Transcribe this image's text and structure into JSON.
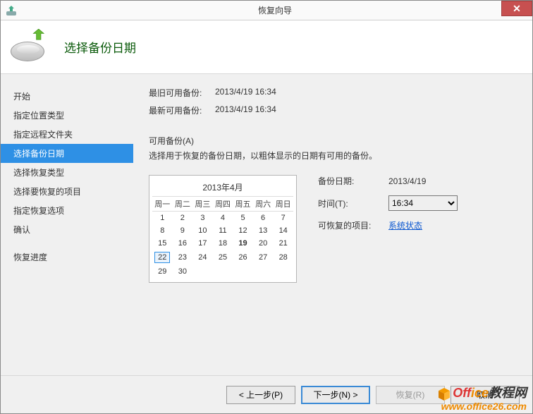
{
  "window": {
    "title": "恢复向导"
  },
  "header": {
    "title": "选择备份日期"
  },
  "sidebar": {
    "items": [
      {
        "label": "开始"
      },
      {
        "label": "指定位置类型"
      },
      {
        "label": "指定远程文件夹"
      },
      {
        "label": "选择备份日期",
        "selected": true
      },
      {
        "label": "选择恢复类型"
      },
      {
        "label": "选择要恢复的项目"
      },
      {
        "label": "指定恢复选项"
      },
      {
        "label": "确认"
      },
      {
        "label": "恢复进度",
        "spacer_before": true
      }
    ]
  },
  "info": {
    "oldest_label": "最旧可用备份:",
    "oldest_value": "2013/4/19 16:34",
    "newest_label": "最新可用备份:",
    "newest_value": "2013/4/19 16:34"
  },
  "available": {
    "title": "可用备份(A)",
    "desc": "选择用于恢复的备份日期，以粗体显示的日期有可用的备份。"
  },
  "calendar": {
    "month_title": "2013年4月",
    "weekdays": [
      "周一",
      "周二",
      "周三",
      "周四",
      "周五",
      "周六",
      "周日"
    ],
    "weeks": [
      [
        {
          "d": "1"
        },
        {
          "d": "2"
        },
        {
          "d": "3"
        },
        {
          "d": "4"
        },
        {
          "d": "5"
        },
        {
          "d": "6"
        },
        {
          "d": "7"
        }
      ],
      [
        {
          "d": "8"
        },
        {
          "d": "9"
        },
        {
          "d": "10"
        },
        {
          "d": "11"
        },
        {
          "d": "12"
        },
        {
          "d": "13"
        },
        {
          "d": "14"
        }
      ],
      [
        {
          "d": "15"
        },
        {
          "d": "16"
        },
        {
          "d": "17"
        },
        {
          "d": "18"
        },
        {
          "d": "19",
          "bold": true
        },
        {
          "d": "20"
        },
        {
          "d": "21"
        }
      ],
      [
        {
          "d": "22",
          "selected": true
        },
        {
          "d": "23"
        },
        {
          "d": "24"
        },
        {
          "d": "25"
        },
        {
          "d": "26"
        },
        {
          "d": "27"
        },
        {
          "d": "28"
        }
      ],
      [
        {
          "d": "29"
        },
        {
          "d": "30"
        },
        {
          "d": ""
        },
        {
          "d": ""
        },
        {
          "d": ""
        },
        {
          "d": ""
        },
        {
          "d": ""
        }
      ]
    ]
  },
  "details": {
    "backup_date_label": "备份日期:",
    "backup_date_value": "2013/4/19",
    "time_label": "时间(T):",
    "time_value": "16:34",
    "recoverable_label": "可恢复的项目:",
    "recoverable_link": "系统状态"
  },
  "footer": {
    "prev": "< 上一步(P)",
    "next": "下一步(N) >",
    "recover": "恢复(R)",
    "cancel": "取消"
  },
  "watermark": {
    "line1_red": "Off",
    "line1_orange": "ice",
    "line1_tail": "教程网",
    "line2": "www.office26.com"
  }
}
